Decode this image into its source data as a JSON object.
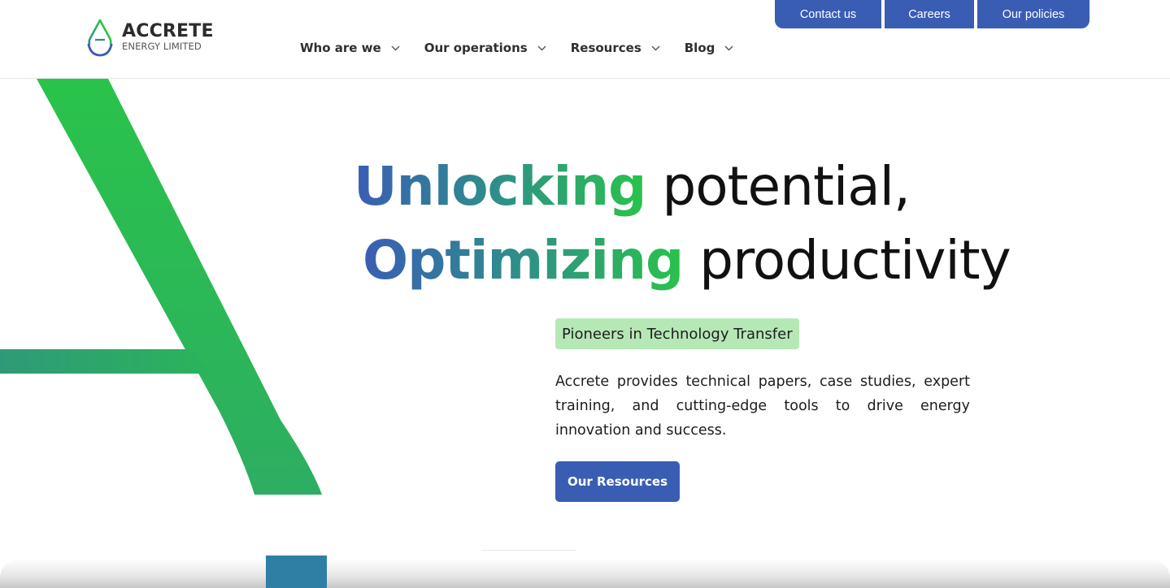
{
  "brand": {
    "name": "ACCRETE",
    "subtitle": "ENERGY LIMITED",
    "colors": {
      "blue": "#3a5db4",
      "green": "#29c34a",
      "teal": "#2f8b8d",
      "tag_bg": "#b6e8b6"
    }
  },
  "header": {
    "nav": [
      {
        "label": "Who are we",
        "icon": "chevron-down-icon"
      },
      {
        "label": "Our operations",
        "icon": "chevron-down-icon"
      },
      {
        "label": "Resources",
        "icon": "chevron-down-icon"
      },
      {
        "label": "Blog",
        "icon": "chevron-down-icon"
      }
    ],
    "top_buttons": [
      {
        "label": "Contact us"
      },
      {
        "label": "Careers"
      },
      {
        "label": "Our policies"
      }
    ]
  },
  "hero": {
    "line1_highlight": "Unlocking",
    "line1_rest": "potential,",
    "line2_highlight": "Optimizing",
    "line2_rest": "productivity",
    "tag": "Pioneers in Technology Transfer",
    "description": "Accrete provides technical papers, case studies, expert training, and cutting-edge tools to drive energy innovation and success.",
    "cta_label": "Our Resources"
  }
}
